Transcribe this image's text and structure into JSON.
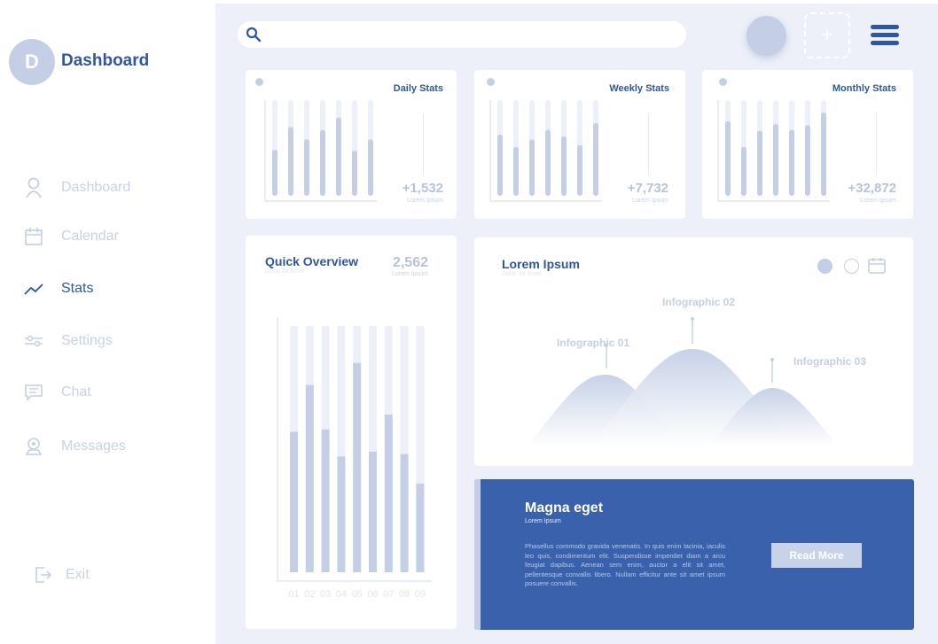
{
  "sidebar": {
    "logo_letter": "D",
    "brand": "Dashboard",
    "items": [
      {
        "label": "Dashboard",
        "icon": "user-icon"
      },
      {
        "label": "Calendar",
        "icon": "calendar-icon"
      },
      {
        "label": "Stats",
        "icon": "trend-icon"
      },
      {
        "label": "Settings",
        "icon": "sliders-icon"
      },
      {
        "label": "Chat",
        "icon": "chat-icon"
      },
      {
        "label": "Messages",
        "icon": "notification-icon"
      }
    ],
    "active_item": "Stats",
    "exit_label": "Exit"
  },
  "header": {
    "search_placeholder": "",
    "add_symbol": "+"
  },
  "cards": [
    {
      "title": "Daily Stats",
      "value": "+1,532",
      "sub": "Lorem Ipsum"
    },
    {
      "title": "Weekly Stats",
      "value": "+7,732",
      "sub": "Lorem Ipsum"
    },
    {
      "title": "Monthly Stats",
      "value": "+32,872",
      "sub": "Lorem Ipsum"
    }
  ],
  "overview": {
    "title": "Quick Overview",
    "subtitle": "Dolor Sit Amet",
    "value": "2,562",
    "value_sub": "Lorem Ipsum"
  },
  "infographic": {
    "title": "Lorem Ipsum",
    "subtitle": "Dolor Sit Amet",
    "labels": [
      "Infographic 01",
      "Infographic 02",
      "Infographic 03"
    ]
  },
  "feature": {
    "title": "Magna eget",
    "subtitle": "Lorem Ipsum",
    "body": "Phasellus commodo gravida venenatis. In quis enim lacinia, iaculis leo quis, condimentum elit. Suspendisse imperdiet diam a arcu feugiat dapibus. Aenean sem enim, auctor a elit sit amet, pellentesque convallis libero. Nullam efficitur ante sit amet ipsum posuere convallis.",
    "button": "Read More"
  },
  "colors": {
    "accent": "#2f56a3",
    "feature_bg": "#3a61ab",
    "muted": "#c4cfe6",
    "background": "#edf0f8"
  },
  "chart_data": [
    {
      "type": "bar",
      "title": "Daily Stats",
      "values": [
        0.48,
        0.72,
        0.59,
        0.69,
        0.82,
        0.47,
        0.59
      ]
    },
    {
      "type": "bar",
      "title": "Weekly Stats",
      "values": [
        0.64,
        0.51,
        0.59,
        0.69,
        0.62,
        0.53,
        0.76
      ]
    },
    {
      "type": "bar",
      "title": "Monthly Stats",
      "values": [
        0.78,
        0.51,
        0.68,
        0.75,
        0.69,
        0.74,
        0.87
      ]
    },
    {
      "type": "bar",
      "title": "Quick Overview",
      "categories": [
        "01",
        "02",
        "03",
        "04",
        "05",
        "06",
        "07",
        "08",
        "09"
      ],
      "values": [
        0.57,
        0.76,
        0.58,
        0.47,
        0.85,
        0.49,
        0.64,
        0.48,
        0.36
      ]
    }
  ]
}
